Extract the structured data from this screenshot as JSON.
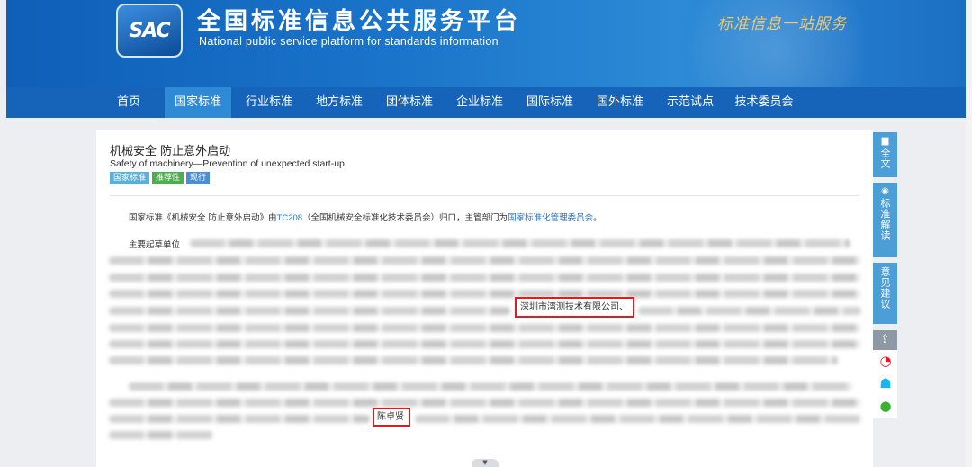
{
  "header": {
    "logo_text": "SAC",
    "site_title": "全国标准信息公共服务平台",
    "site_subtitle": "National public service platform  for standards information",
    "slogan": "标准信息一站服务"
  },
  "nav": {
    "items": [
      {
        "label": "首页",
        "active": false
      },
      {
        "label": "国家标准",
        "active": true
      },
      {
        "label": "行业标准",
        "active": false
      },
      {
        "label": "地方标准",
        "active": false
      },
      {
        "label": "团体标准",
        "active": false
      },
      {
        "label": "企业标准",
        "active": false
      },
      {
        "label": "国际标准",
        "active": false
      },
      {
        "label": "国外标准",
        "active": false
      },
      {
        "label": "示范试点",
        "active": false
      },
      {
        "label": "技术委员会",
        "active": false
      }
    ]
  },
  "standard": {
    "title_cn": "机械安全 防止意外启动",
    "title_en": "Safety of machinery—Prevention of unexpected start-up",
    "tags": [
      "国家标准",
      "推荐性",
      "现行"
    ],
    "desc_prefix": "国家标准《机械安全 防止意外启动》由",
    "committee_code": "TC208",
    "desc_middle": "（全国机械安全标准化技术委员会）归口，主管部门为",
    "authority": "国家标准化管理委员会",
    "desc_suffix": "。",
    "drafters_label": "主要起草单位",
    "highlighted_unit": "深圳市湾测技术有限公司",
    "highlighted_unit_suffix": "、",
    "highlighted_person": "陈卓贤"
  },
  "side_tools": {
    "fulltext": {
      "icon": "document-icon",
      "label": "全文"
    },
    "interpret": {
      "icon": "circle-icon",
      "label": "标准解读"
    },
    "feedback": {
      "label": "意见建议"
    },
    "share_icons": [
      "share-icon",
      "weibo-icon",
      "qq-icon",
      "wechat-icon"
    ]
  },
  "colors": {
    "nav_bg": "#1664b9",
    "nav_active": "#2f8ad6",
    "highlight_border": "#d71f26",
    "link": "#2a6fc0",
    "side_button": "#4c9ed6"
  }
}
